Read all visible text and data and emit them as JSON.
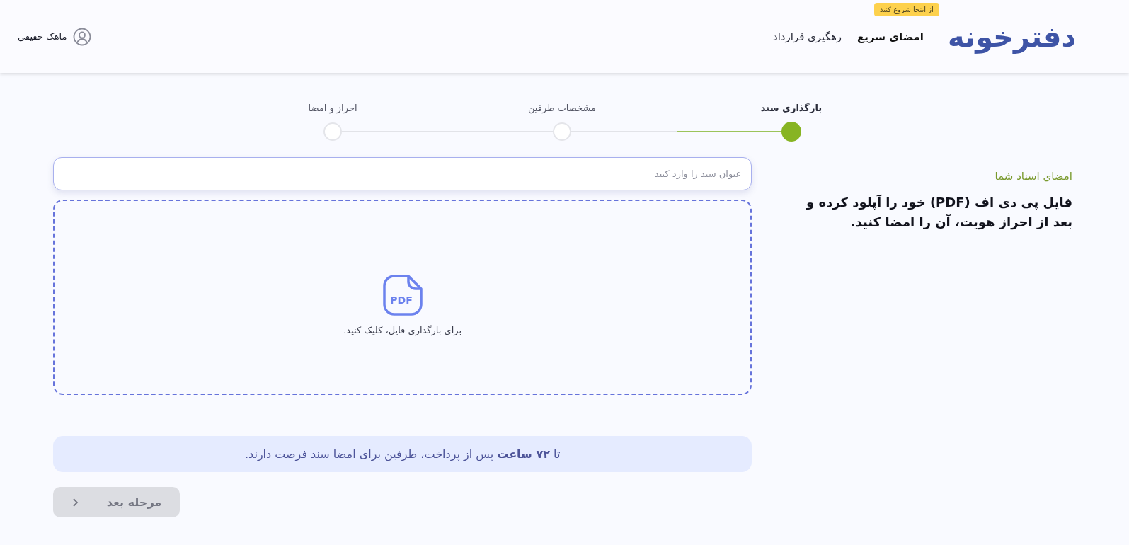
{
  "header": {
    "logo": "دفترخونه",
    "nav": [
      {
        "label": "امضای سریع",
        "selected": true,
        "badge": "از اینجا شروع کنید"
      },
      {
        "label": "رهگیری قرارداد",
        "selected": false
      }
    ],
    "user": {
      "name": "ماهک حقیقی"
    }
  },
  "steps": [
    {
      "label": "بارگذاری سند",
      "done": true
    },
    {
      "label": "مشخصات طرفین",
      "done": false
    },
    {
      "label": "احراز و امضا",
      "done": false
    }
  ],
  "intro": {
    "heading": "امضای اسناد شما",
    "text": "فایل پی دی اف (PDF) خود را آپلود کرده و بعد از احراز هویت، آن را امضا کنید."
  },
  "form": {
    "title_field": {
      "placeholder": "عنوان سند را وارد کنید"
    },
    "upload": {
      "icon_label": "PDF",
      "hint": "برای بارگذاری فایل، کلیک کنید."
    },
    "notice": "تا **۷۲ ساعت** پس از پرداخت، طرفین برای امضا سند فرصت دارند.",
    "next_button": {
      "label": "مرحله بعد",
      "disabled": true
    }
  }
}
